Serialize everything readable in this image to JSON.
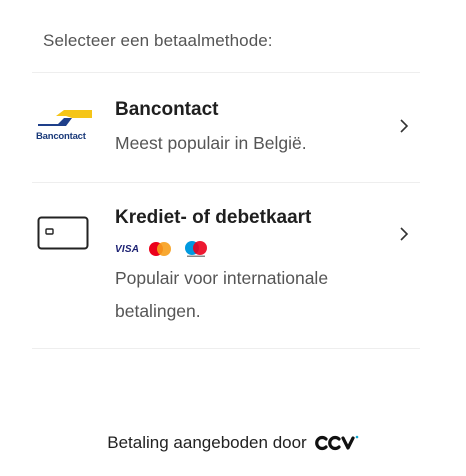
{
  "heading": "Selecteer een betaalmethode:",
  "methods": [
    {
      "title": "Bancontact",
      "description": "Meest populair in België.",
      "logo_text": "Bancontact",
      "icon": "bancontact-logo"
    },
    {
      "title": "Krediet- of debetkaart",
      "description_line1": "Populair voor internationale",
      "description_line2": "betalingen.",
      "icon": "credit-card-icon",
      "brands": [
        "VISA",
        "Mastercard",
        "Maestro"
      ]
    }
  ],
  "footer": {
    "text": "Betaling aangeboden door",
    "brand": "CCV"
  },
  "colors": {
    "bancontact_blue": "#1e3f8a",
    "bancontact_yellow": "#f5c518",
    "visa_blue": "#1a1f71",
    "mastercard_red": "#eb001b",
    "mastercard_orange": "#f79e1b",
    "maestro_blue": "#0099df",
    "ccv_teal": "#12a9d0"
  }
}
